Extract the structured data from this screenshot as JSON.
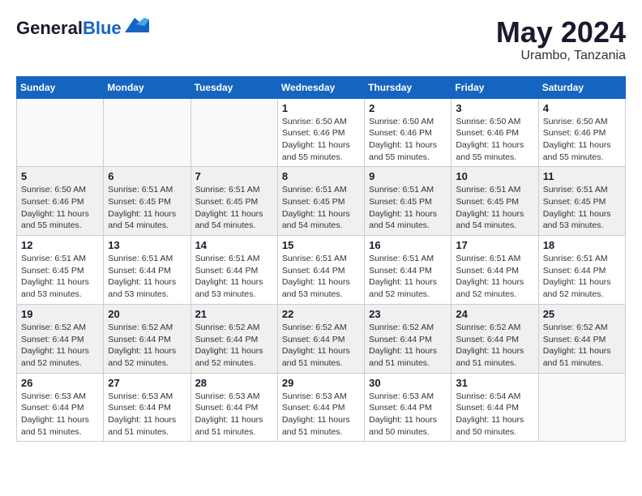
{
  "header": {
    "logo_general": "General",
    "logo_blue": "Blue",
    "month_title": "May 2024",
    "location": "Urambo, Tanzania"
  },
  "weekdays": [
    "Sunday",
    "Monday",
    "Tuesday",
    "Wednesday",
    "Thursday",
    "Friday",
    "Saturday"
  ],
  "weeks": [
    [
      {
        "day": "",
        "sunrise": "",
        "sunset": "",
        "daylight": ""
      },
      {
        "day": "",
        "sunrise": "",
        "sunset": "",
        "daylight": ""
      },
      {
        "day": "",
        "sunrise": "",
        "sunset": "",
        "daylight": ""
      },
      {
        "day": "1",
        "sunrise": "Sunrise: 6:50 AM",
        "sunset": "Sunset: 6:46 PM",
        "daylight": "Daylight: 11 hours and 55 minutes."
      },
      {
        "day": "2",
        "sunrise": "Sunrise: 6:50 AM",
        "sunset": "Sunset: 6:46 PM",
        "daylight": "Daylight: 11 hours and 55 minutes."
      },
      {
        "day": "3",
        "sunrise": "Sunrise: 6:50 AM",
        "sunset": "Sunset: 6:46 PM",
        "daylight": "Daylight: 11 hours and 55 minutes."
      },
      {
        "day": "4",
        "sunrise": "Sunrise: 6:50 AM",
        "sunset": "Sunset: 6:46 PM",
        "daylight": "Daylight: 11 hours and 55 minutes."
      }
    ],
    [
      {
        "day": "5",
        "sunrise": "Sunrise: 6:50 AM",
        "sunset": "Sunset: 6:46 PM",
        "daylight": "Daylight: 11 hours and 55 minutes."
      },
      {
        "day": "6",
        "sunrise": "Sunrise: 6:51 AM",
        "sunset": "Sunset: 6:45 PM",
        "daylight": "Daylight: 11 hours and 54 minutes."
      },
      {
        "day": "7",
        "sunrise": "Sunrise: 6:51 AM",
        "sunset": "Sunset: 6:45 PM",
        "daylight": "Daylight: 11 hours and 54 minutes."
      },
      {
        "day": "8",
        "sunrise": "Sunrise: 6:51 AM",
        "sunset": "Sunset: 6:45 PM",
        "daylight": "Daylight: 11 hours and 54 minutes."
      },
      {
        "day": "9",
        "sunrise": "Sunrise: 6:51 AM",
        "sunset": "Sunset: 6:45 PM",
        "daylight": "Daylight: 11 hours and 54 minutes."
      },
      {
        "day": "10",
        "sunrise": "Sunrise: 6:51 AM",
        "sunset": "Sunset: 6:45 PM",
        "daylight": "Daylight: 11 hours and 54 minutes."
      },
      {
        "day": "11",
        "sunrise": "Sunrise: 6:51 AM",
        "sunset": "Sunset: 6:45 PM",
        "daylight": "Daylight: 11 hours and 53 minutes."
      }
    ],
    [
      {
        "day": "12",
        "sunrise": "Sunrise: 6:51 AM",
        "sunset": "Sunset: 6:45 PM",
        "daylight": "Daylight: 11 hours and 53 minutes."
      },
      {
        "day": "13",
        "sunrise": "Sunrise: 6:51 AM",
        "sunset": "Sunset: 6:44 PM",
        "daylight": "Daylight: 11 hours and 53 minutes."
      },
      {
        "day": "14",
        "sunrise": "Sunrise: 6:51 AM",
        "sunset": "Sunset: 6:44 PM",
        "daylight": "Daylight: 11 hours and 53 minutes."
      },
      {
        "day": "15",
        "sunrise": "Sunrise: 6:51 AM",
        "sunset": "Sunset: 6:44 PM",
        "daylight": "Daylight: 11 hours and 53 minutes."
      },
      {
        "day": "16",
        "sunrise": "Sunrise: 6:51 AM",
        "sunset": "Sunset: 6:44 PM",
        "daylight": "Daylight: 11 hours and 52 minutes."
      },
      {
        "day": "17",
        "sunrise": "Sunrise: 6:51 AM",
        "sunset": "Sunset: 6:44 PM",
        "daylight": "Daylight: 11 hours and 52 minutes."
      },
      {
        "day": "18",
        "sunrise": "Sunrise: 6:51 AM",
        "sunset": "Sunset: 6:44 PM",
        "daylight": "Daylight: 11 hours and 52 minutes."
      }
    ],
    [
      {
        "day": "19",
        "sunrise": "Sunrise: 6:52 AM",
        "sunset": "Sunset: 6:44 PM",
        "daylight": "Daylight: 11 hours and 52 minutes."
      },
      {
        "day": "20",
        "sunrise": "Sunrise: 6:52 AM",
        "sunset": "Sunset: 6:44 PM",
        "daylight": "Daylight: 11 hours and 52 minutes."
      },
      {
        "day": "21",
        "sunrise": "Sunrise: 6:52 AM",
        "sunset": "Sunset: 6:44 PM",
        "daylight": "Daylight: 11 hours and 52 minutes."
      },
      {
        "day": "22",
        "sunrise": "Sunrise: 6:52 AM",
        "sunset": "Sunset: 6:44 PM",
        "daylight": "Daylight: 11 hours and 51 minutes."
      },
      {
        "day": "23",
        "sunrise": "Sunrise: 6:52 AM",
        "sunset": "Sunset: 6:44 PM",
        "daylight": "Daylight: 11 hours and 51 minutes."
      },
      {
        "day": "24",
        "sunrise": "Sunrise: 6:52 AM",
        "sunset": "Sunset: 6:44 PM",
        "daylight": "Daylight: 11 hours and 51 minutes."
      },
      {
        "day": "25",
        "sunrise": "Sunrise: 6:52 AM",
        "sunset": "Sunset: 6:44 PM",
        "daylight": "Daylight: 11 hours and 51 minutes."
      }
    ],
    [
      {
        "day": "26",
        "sunrise": "Sunrise: 6:53 AM",
        "sunset": "Sunset: 6:44 PM",
        "daylight": "Daylight: 11 hours and 51 minutes."
      },
      {
        "day": "27",
        "sunrise": "Sunrise: 6:53 AM",
        "sunset": "Sunset: 6:44 PM",
        "daylight": "Daylight: 11 hours and 51 minutes."
      },
      {
        "day": "28",
        "sunrise": "Sunrise: 6:53 AM",
        "sunset": "Sunset: 6:44 PM",
        "daylight": "Daylight: 11 hours and 51 minutes."
      },
      {
        "day": "29",
        "sunrise": "Sunrise: 6:53 AM",
        "sunset": "Sunset: 6:44 PM",
        "daylight": "Daylight: 11 hours and 51 minutes."
      },
      {
        "day": "30",
        "sunrise": "Sunrise: 6:53 AM",
        "sunset": "Sunset: 6:44 PM",
        "daylight": "Daylight: 11 hours and 50 minutes."
      },
      {
        "day": "31",
        "sunrise": "Sunrise: 6:54 AM",
        "sunset": "Sunset: 6:44 PM",
        "daylight": "Daylight: 11 hours and 50 minutes."
      },
      {
        "day": "",
        "sunrise": "",
        "sunset": "",
        "daylight": ""
      }
    ]
  ]
}
